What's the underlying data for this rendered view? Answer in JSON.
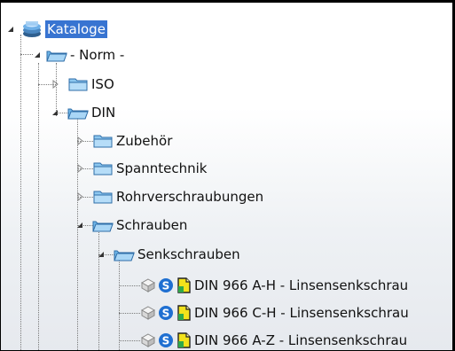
{
  "tree": {
    "root": {
      "label": "Kataloge",
      "icon": "catalog-stack-icon",
      "selected": true
    },
    "norm": {
      "label": "- Norm -",
      "icon": "folder-open-icon"
    },
    "iso": {
      "label": "ISO",
      "icon": "folder-closed-icon"
    },
    "din": {
      "label": "DIN",
      "icon": "folder-open-icon"
    },
    "zubehoer": {
      "label": "Zubehör",
      "icon": "folder-closed-icon"
    },
    "spanntechnik": {
      "label": "Spanntechnik",
      "icon": "folder-closed-icon"
    },
    "rohrverschraubungen": {
      "label": "Rohrverschraubungen",
      "icon": "folder-closed-icon"
    },
    "schrauben": {
      "label": "Schrauben",
      "icon": "folder-open-icon"
    },
    "senkschrauben": {
      "label": "Senkschrauben",
      "icon": "folder-open-icon"
    },
    "items": [
      {
        "label": "DIN 966 A-H - Linsensenkschrau"
      },
      {
        "label": "DIN 966 C-H - Linsensenkschrau"
      },
      {
        "label": "DIN 966 A-Z - Linsensenkschrau"
      }
    ]
  },
  "colors": {
    "selection": "#3874d1",
    "folder_blue": "#5aa7e0",
    "badge_blue": "#1f6fd1",
    "doc_yellow": "#f2e21b"
  }
}
